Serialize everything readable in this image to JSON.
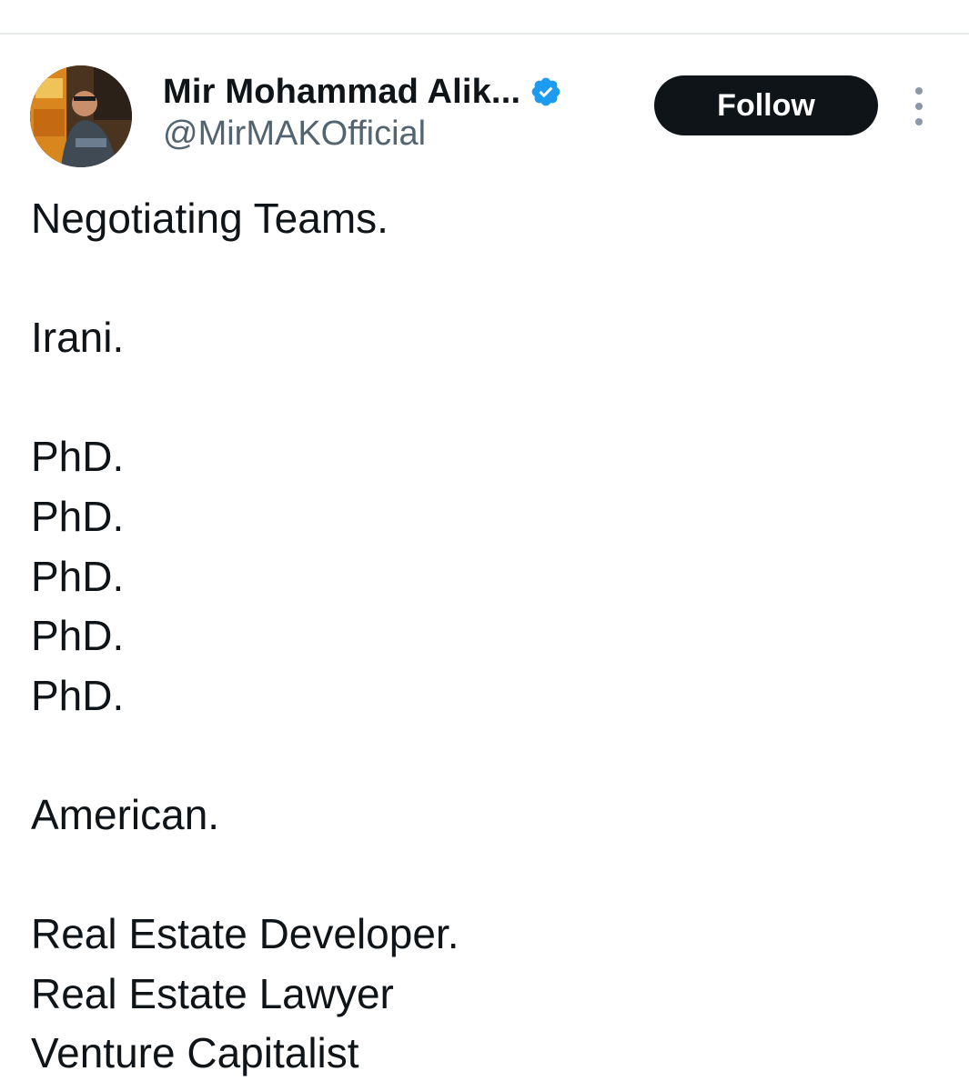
{
  "author": {
    "display_name": "Mir Mohammad Alik...",
    "handle": "@MirMAKOfficial",
    "verified": true,
    "verified_color": "#1d9bf0",
    "avatar_icon": "profile-photo"
  },
  "follow_label": "Follow",
  "more_icon": "more-vertical-icon",
  "tweet": {
    "lines": [
      "Negotiating Teams.",
      "",
      "Irani.",
      "",
      "PhD.",
      "PhD.",
      "PhD.",
      "PhD.",
      "PhD.",
      "",
      "American.",
      "",
      "Real Estate Developer.",
      "Real Estate Lawyer",
      "Venture Capitalist"
    ]
  },
  "colors": {
    "text": "#0f1419",
    "secondary_text": "#536471",
    "button_bg": "#0f1419",
    "button_text": "#ffffff",
    "divider": "#e6e9ec"
  }
}
